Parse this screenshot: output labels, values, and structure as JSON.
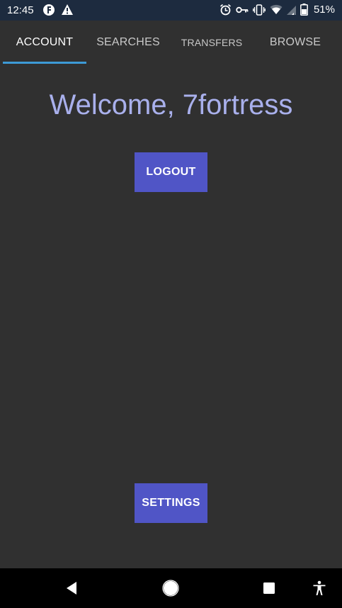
{
  "status_bar": {
    "time": "12:45",
    "battery_percent": "51%",
    "left_icons": [
      "notification-f-icon",
      "warning-icon"
    ],
    "right_icons": [
      "alarm-icon",
      "vpn-key-icon",
      "vibrate-icon",
      "wifi-icon",
      "signal-icon",
      "battery-icon"
    ]
  },
  "tabs": [
    {
      "label": "ACCOUNT",
      "active": true
    },
    {
      "label": "SEARCHES",
      "active": false
    },
    {
      "label": "TRANSFERS",
      "active": false
    },
    {
      "label": "BROWSE",
      "active": false
    }
  ],
  "main": {
    "welcome_text": "Welcome, 7fortress",
    "logout_label": "LOGOUT",
    "settings_label": "SETTINGS"
  },
  "nav_bar": {
    "icons": [
      "back-icon",
      "home-icon",
      "recents-icon",
      "accessibility-icon"
    ]
  },
  "colors": {
    "background": "#303030",
    "status_bar": "#1d2b3f",
    "accent_button": "#5055c6",
    "welcome_text": "#a9b0ec",
    "tab_indicator": "#3d9ad6"
  }
}
